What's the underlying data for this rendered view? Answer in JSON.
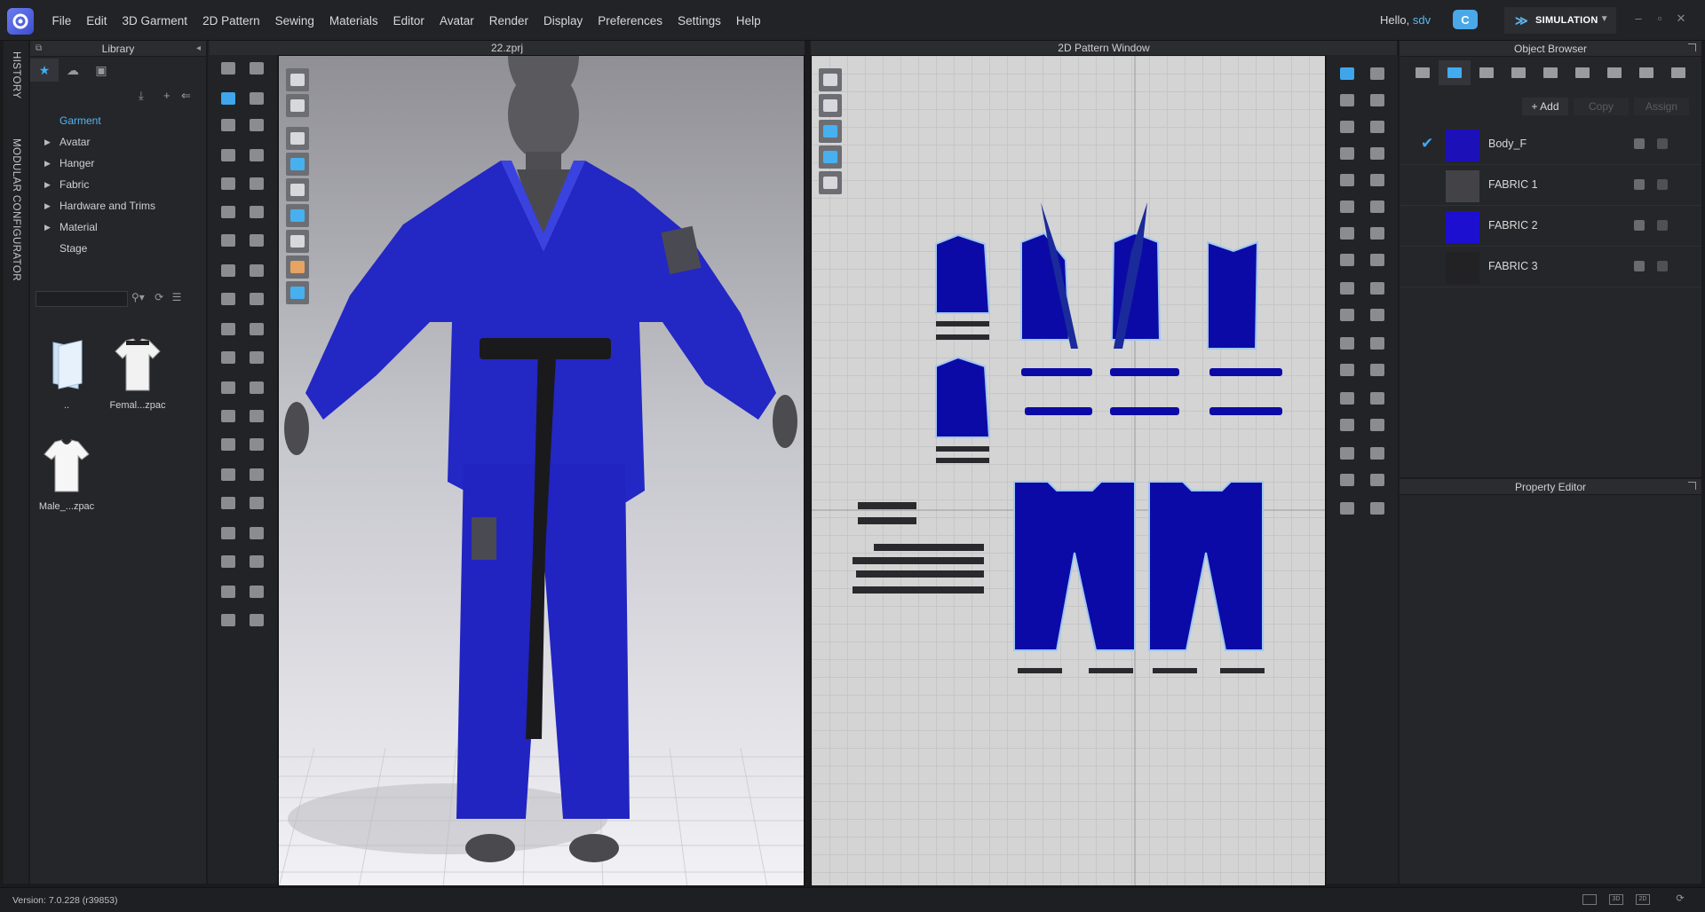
{
  "menu": {
    "items": [
      "File",
      "Edit",
      "3D Garment",
      "2D Pattern",
      "Sewing",
      "Materials",
      "Editor",
      "Avatar",
      "Render",
      "Display",
      "Preferences",
      "Settings",
      "Help"
    ],
    "greeting": "Hello,",
    "user": "sdv",
    "mode": "SIMULATION"
  },
  "side_tabs": {
    "history": "HISTORY",
    "modular": "MODULAR CONFIGURATOR"
  },
  "library": {
    "title": "Library",
    "tree": [
      {
        "label": "Garment",
        "selected": true,
        "expandable": false
      },
      {
        "label": "Avatar",
        "expandable": true
      },
      {
        "label": "Hanger",
        "expandable": true
      },
      {
        "label": "Fabric",
        "expandable": true
      },
      {
        "label": "Hardware and Trims",
        "expandable": true
      },
      {
        "label": "Material",
        "expandable": true
      },
      {
        "label": "Stage",
        "expandable": false
      }
    ],
    "thumbs": [
      "..",
      "Femal...zpac",
      "Male_...zpac"
    ]
  },
  "viewport3d": {
    "title": "22.zprj"
  },
  "viewport2d": {
    "title": "2D Pattern Window"
  },
  "object_browser": {
    "title": "Object Browser",
    "add_label": "Add",
    "copy_label": "Copy",
    "assign_label": "Assign",
    "fabrics": [
      {
        "name": "Body_F",
        "color": "#1c10b8",
        "checked": true
      },
      {
        "name": "FABRIC 1",
        "color": "#434347",
        "checked": false
      },
      {
        "name": "FABRIC 2",
        "color": "#1d0fd0",
        "checked": false
      },
      {
        "name": "FABRIC 3",
        "color": "#222225",
        "checked": false
      }
    ]
  },
  "property_editor": {
    "title": "Property Editor"
  },
  "status": {
    "version": "Version: 7.0.228 (r39853)",
    "view_3d": "3D",
    "view_2d": "2D"
  },
  "colors": {
    "accent": "#42aef0",
    "garment": "#2128c8",
    "pattern": "#0a0aa0"
  }
}
